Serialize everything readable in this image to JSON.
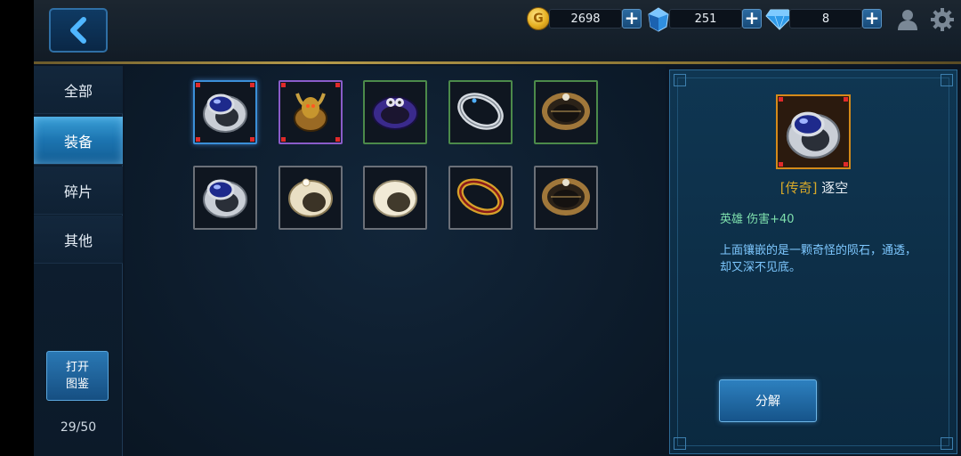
{
  "currencies": {
    "gold": "2698",
    "crystal": "251",
    "diamond": "8",
    "plus_label": "+",
    "coin_letter": "G"
  },
  "sidebar": {
    "tabs": [
      {
        "label": "全部",
        "active": false
      },
      {
        "label": "装备",
        "active": true
      },
      {
        "label": "碎片",
        "active": false
      },
      {
        "label": "其他",
        "active": false
      }
    ],
    "open_button": {
      "line1": "打开",
      "line2": "图鉴"
    },
    "count": "29/50"
  },
  "inventory": {
    "rows": [
      [
        {
          "icon": "blue-gem-silver-ring-icon",
          "frame": "blue",
          "selected": true
        },
        {
          "icon": "horned-gold-ring-icon",
          "frame": "purple",
          "selected": false
        },
        {
          "icon": "purple-skull-ring-icon",
          "frame": "green",
          "selected": false
        },
        {
          "icon": "silver-filigree-ring-icon",
          "frame": "green",
          "selected": false
        },
        {
          "icon": "bronze-star-ring-icon",
          "frame": "green",
          "selected": false
        }
      ],
      [
        {
          "icon": "blue-gem-silver-ring-icon",
          "frame": "gray",
          "selected": false
        },
        {
          "icon": "pearl-ring-icon",
          "frame": "gray",
          "selected": false
        },
        {
          "icon": "plain-ivory-ring-icon",
          "frame": "gray",
          "selected": false
        },
        {
          "icon": "gold-ruby-band-icon",
          "frame": "gray",
          "selected": false
        },
        {
          "icon": "bronze-star-ring-icon",
          "frame": "gray",
          "selected": false
        }
      ]
    ]
  },
  "detail": {
    "icon": "blue-gem-silver-ring-icon",
    "rarity": "[传奇]",
    "name": "逐空",
    "stat": "英雄 伤害+40",
    "description": "上面镶嵌的是一颗奇怪的陨石，通透，却又深不见底。",
    "decompose_label": "分解"
  },
  "colors": {
    "active_tab": "#1c74b0",
    "rarity_gold": "#d6a829",
    "stat_green": "#7fe0ad",
    "desc_blue": "#7ec8ff",
    "selected_frame": "#3b8fd8"
  }
}
